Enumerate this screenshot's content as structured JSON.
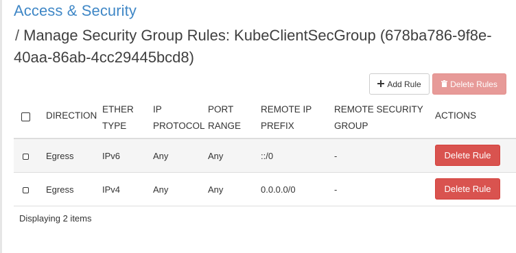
{
  "breadcrumb": {
    "section": "Access & Security",
    "separator": "/"
  },
  "page": {
    "title": "Manage Security Group Rules: KubeClientSecGroup (678ba786-9f8e-40aa-86ab-4cc29445bcd8)"
  },
  "actions": {
    "add_rule": "Add Rule",
    "delete_rules": "Delete Rules"
  },
  "table": {
    "columns": {
      "direction": "DIRECTION",
      "ether_type_line1": "ETHER",
      "ether_type_line2": "TYPE",
      "ip_protocol_line1": "IP",
      "ip_protocol_line2": "PROTOCOL",
      "port_range_line1": "PORT",
      "port_range_line2": "RANGE",
      "remote_ip_prefix_line1": "REMOTE IP",
      "remote_ip_prefix_line2": "PREFIX",
      "remote_security_group_line1": "REMOTE SECURITY",
      "remote_security_group_line2": "GROUP",
      "actions": "ACTIONS"
    },
    "rows": [
      {
        "direction": "Egress",
        "ether_type": "IPv6",
        "ip_protocol": "Any",
        "port_range": "Any",
        "remote_ip_prefix": "::/0",
        "remote_security_group": "-",
        "action": "Delete Rule"
      },
      {
        "direction": "Egress",
        "ether_type": "IPv4",
        "ip_protocol": "Any",
        "port_range": "Any",
        "remote_ip_prefix": "0.0.0.0/0",
        "remote_security_group": "-",
        "action": "Delete Rule"
      }
    ],
    "footer": "Displaying 2 items"
  },
  "colors": {
    "link": "#3f87c6",
    "danger": "#d9534f",
    "danger_disabled": "#e79a98"
  },
  "icons": {
    "add": "plus-icon",
    "delete": "trash-icon"
  }
}
